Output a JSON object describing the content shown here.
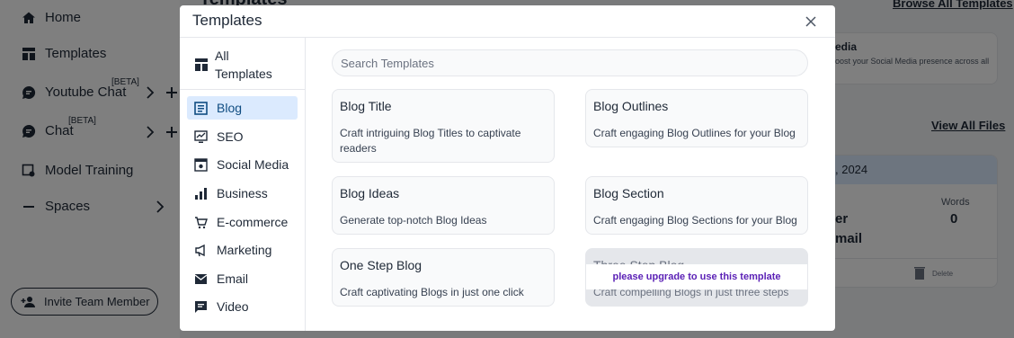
{
  "sidebar": {
    "home": "Home",
    "templates": "Templates",
    "youtube_chat": "Youtube Chat",
    "youtube_chat_badge": "[BETA]",
    "chat": "Chat",
    "chat_badge": "[BETA]",
    "model_training": "Model Training",
    "spaces": "Spaces",
    "invite": "Invite Team Member"
  },
  "background": {
    "page_title": "Templates",
    "browse_all": "Browse All Templates",
    "card_title": "edia",
    "card_desc": "oost your Social Media presence across all",
    "view_all_files": "View All Files",
    "file_date": ", 2024",
    "words_label": "Words",
    "words_value": "0",
    "frag1": "er",
    "frag2": "mail",
    "delete": "Delete"
  },
  "modal": {
    "title": "Templates",
    "all_templates": "All Templates",
    "search_placeholder": "Search Templates",
    "upgrade_message": "please upgrade to use this template",
    "categories": [
      {
        "label": "Blog",
        "icon": "blog-icon",
        "active": true
      },
      {
        "label": "SEO",
        "icon": "seo-icon"
      },
      {
        "label": "Social Media",
        "icon": "social-media-icon"
      },
      {
        "label": "Business",
        "icon": "business-icon"
      },
      {
        "label": "E-commerce",
        "icon": "cart-icon"
      },
      {
        "label": "Marketing",
        "icon": "megaphone-icon"
      },
      {
        "label": "Email",
        "icon": "email-icon"
      },
      {
        "label": "Video",
        "icon": "video-icon"
      }
    ],
    "templates": [
      {
        "title": "Blog Title",
        "desc": "Craft intriguing Blog Titles to captivate readers"
      },
      {
        "title": "Blog Outlines",
        "desc": "Craft engaging Blog Outlines for your Blog"
      },
      {
        "title": "Blog Ideas",
        "desc": "Generate top-notch Blog Ideas"
      },
      {
        "title": "Blog Section",
        "desc": "Craft engaging Blog Sections for your Blog"
      },
      {
        "title": "One Step Blog",
        "desc": "Craft captivating Blogs in just one click"
      },
      {
        "title": "Three Step Blog",
        "desc": "Craft compelling Blogs in just three steps",
        "locked": true
      }
    ]
  },
  "colors": {
    "accent": "#0f4c81",
    "active_bg": "#dbeafe",
    "upgrade_text": "#5b21b6",
    "overlay": "rgba(0,0,0,0.5)"
  }
}
